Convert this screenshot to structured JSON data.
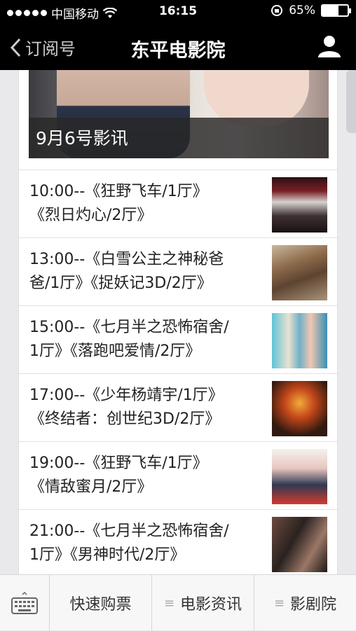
{
  "status_bar": {
    "carrier": "中国移动",
    "time": "16:15",
    "battery": "65%",
    "battery_level": 0.65
  },
  "nav": {
    "back_label": "订阅号",
    "title": "东平电影院"
  },
  "banner": {
    "caption": "9月6号影讯"
  },
  "schedule": [
    {
      "line1": "10:00--《狂野飞车/1厅》",
      "line2": "《烈日灼心/2厅》",
      "thumb": "thumb-1"
    },
    {
      "line1": "13:00--《白雪公主之神秘爸",
      "line2": "爸/1厅》《捉妖记3D/2厅》",
      "thumb": "thumb-2"
    },
    {
      "line1": "15:00--《七月半之恐怖宿舍/",
      "line2": "1厅》《落跑吧爱情/2厅》",
      "thumb": "thumb-3"
    },
    {
      "line1": "17:00--《少年杨靖宇/1厅》",
      "line2": "《终结者：创世纪3D/2厅》",
      "thumb": "thumb-4"
    },
    {
      "line1": "19:00--《狂野飞车/1厅》",
      "line2": "《情敌蜜月/2厅》",
      "thumb": "thumb-5"
    },
    {
      "line1": "21:00--《七月半之恐怖宿舍/",
      "line2": "1厅》《男神时代/2厅》",
      "thumb": "thumb-6"
    }
  ],
  "tabs": {
    "buy": "快速购票",
    "news": "电影资讯",
    "cinema": "影剧院"
  },
  "icons": {
    "menu": "≡"
  }
}
